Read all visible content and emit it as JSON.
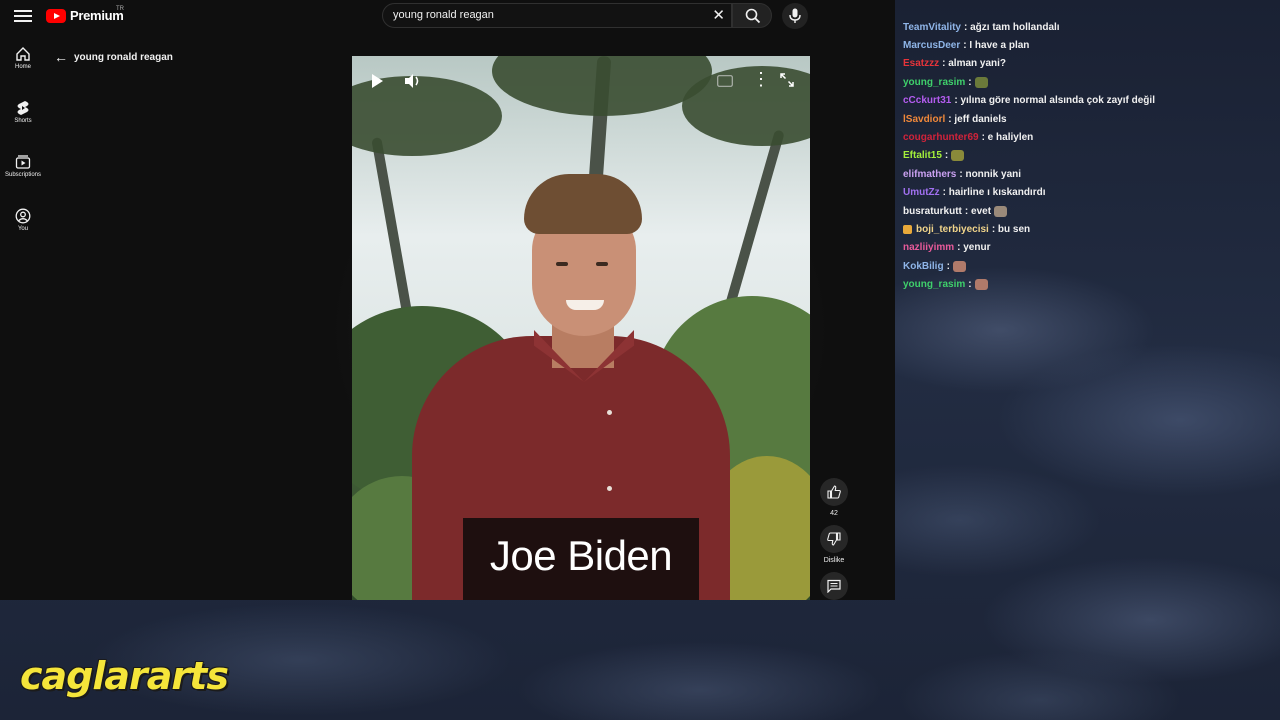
{
  "youtube": {
    "logo_text": "Premium",
    "region": "TR",
    "search": {
      "query": "young ronald  reagan"
    },
    "sidebar": [
      {
        "label": "Home"
      },
      {
        "label": "Shorts"
      },
      {
        "label": "Subscriptions"
      },
      {
        "label": "You"
      }
    ],
    "page_title": "young ronald reagan",
    "video": {
      "caption": "Joe Biden"
    },
    "actions": {
      "like_count": "42",
      "dislike_label": "Dislike"
    }
  },
  "chat": {
    "messages": [
      {
        "user": "TeamVitality",
        "color": "#8fb5e8",
        "text": ": ağzı tam hollandalı"
      },
      {
        "user": "MarcusDeer",
        "color": "#8fb5e8",
        "text": ": I have a plan"
      },
      {
        "user": "Esatzzz",
        "color": "#e8343a",
        "text": ": alman yani?"
      },
      {
        "user": "young_rasim",
        "color": "#3fd06b",
        "text": ":",
        "emote": "#6b7a3a"
      },
      {
        "user": "cCckurt31",
        "color": "#b45cf0",
        "text": ": yılına göre normal alsında çok zayıf değil"
      },
      {
        "user": "lSavdiorl",
        "color": "#f0883a",
        "text": ": jeff daniels"
      },
      {
        "user": "cougarhunter69",
        "color": "#d0233a",
        "text": ": e haliylen"
      },
      {
        "user": "Eftalit15",
        "color": "#a4f03a",
        "text": ":",
        "emote": "#8a8a3a"
      },
      {
        "user": "elifmathers",
        "color": "#c9a0f0",
        "text": ": nonnik yani"
      },
      {
        "user": "UmutZz",
        "color": "#a070f0",
        "text": ": hairline ı kıskandırdı"
      },
      {
        "user": "busraturkutt",
        "color": "#f1f1f1",
        "text": ": evet",
        "emote": "#9a8a7a"
      },
      {
        "user": "boji_terbiyecisi",
        "color": "#f0d48a",
        "text": ": bu sen",
        "badge": true
      },
      {
        "user": "nazliiyimm",
        "color": "#e85a9a",
        "text": ": yenur"
      },
      {
        "user": "KokBilig",
        "color": "#8fb5e8",
        "text": ":",
        "emote": "#b07a6a"
      },
      {
        "user": "young_rasim",
        "color": "#3fd06b",
        "text": ":",
        "emote": "#b07a6a"
      }
    ]
  },
  "watermark": "caglararts"
}
